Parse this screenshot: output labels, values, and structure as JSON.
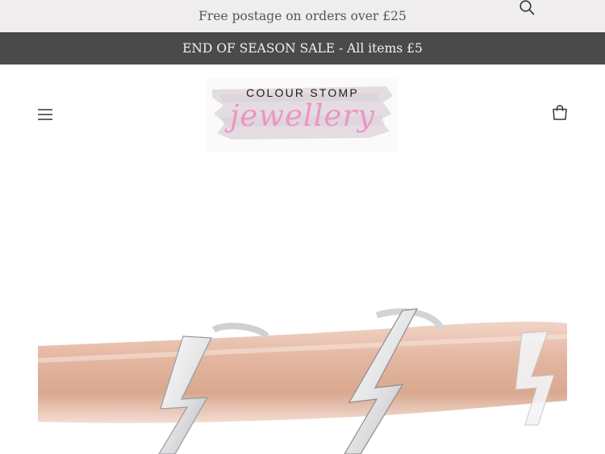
{
  "announcement": {
    "shipping_text": "Free postage on orders over £25",
    "sale_text": "END OF SEASON SALE - All items £5"
  },
  "header": {
    "logo": {
      "line1": "COLOUR STOMP",
      "line2": "jewellery"
    },
    "icons": {
      "menu": "hamburger-menu-icon",
      "search": "search-icon",
      "cart": "cart-icon"
    }
  },
  "hero": {
    "image": "product-photo-silver-lightning-bolt-earrings-on-skin"
  },
  "colors": {
    "announcement_bg": "#efedee",
    "sale_bar_bg": "#4a4a4a",
    "logo_script_pink": "#ef94c5",
    "text_dark": "#1c1c1c"
  }
}
